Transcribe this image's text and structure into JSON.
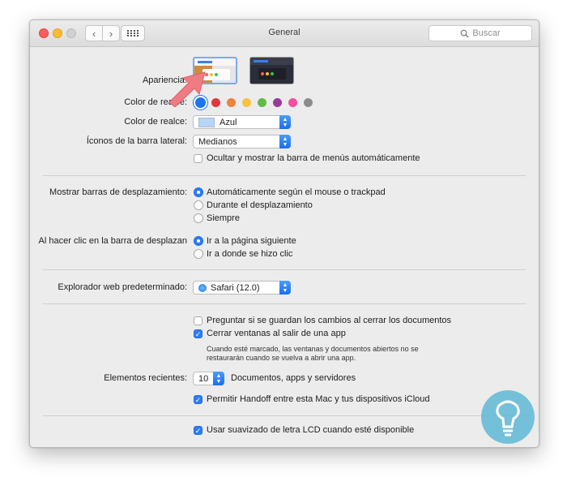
{
  "window": {
    "title": "General",
    "search_placeholder": "Buscar"
  },
  "appearance": {
    "label": "Apariencia:"
  },
  "accent": {
    "label": "Color de realce:",
    "colors": [
      "#1b75ec",
      "#e0383e",
      "#f1813e",
      "#f6c33e",
      "#62ba46",
      "#953d96",
      "#f74f9e",
      "#8c8c8c"
    ]
  },
  "highlight": {
    "label": "Color de realce:",
    "value": "Azul"
  },
  "sidebar_icons": {
    "label": "Íconos de la barra lateral:",
    "value": "Medianos"
  },
  "menubar": {
    "label": "Ocultar y mostrar la barra de menús automáticamente"
  },
  "scrollbars": {
    "label": "Mostrar barras de desplazamiento:",
    "options": [
      "Automáticamente según el mouse o trackpad",
      "Durante el desplazamiento",
      "Siempre"
    ]
  },
  "click_scroll": {
    "label": "Al hacer clic en la barra de desplazan",
    "options": [
      "Ir a la página siguiente",
      "Ir a donde se hizo clic"
    ]
  },
  "browser": {
    "label": "Explorador web predeterminado:",
    "value": "Safari (12.0)"
  },
  "documents": {
    "ask_save": "Preguntar si se guardan los cambios al cerrar los documentos",
    "close_windows": "Cerrar ventanas al salir de una app",
    "note_line1": "Cuando esté marcado, las ventanas y documentos abiertos no se",
    "note_line2": "restaurarán cuando se vuelva a abrir una app."
  },
  "recent": {
    "label": "Elementos recientes:",
    "value": "10",
    "suffix": "Documentos, apps y servidores"
  },
  "handoff": {
    "label": "Permitir Handoff entre esta Mac y tus dispositivos iCloud"
  },
  "lcd": {
    "label": "Usar suavizado de letra LCD cuando esté disponible"
  }
}
